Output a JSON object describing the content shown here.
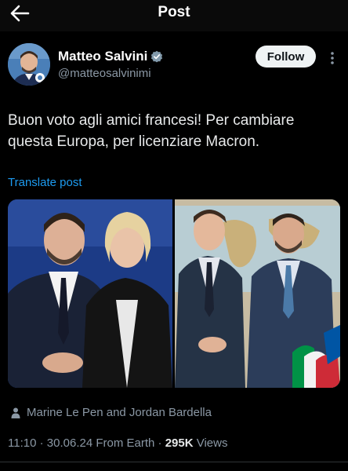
{
  "header": {
    "title": "Post",
    "back_icon": "arrow-left-icon",
    "more_icon": "more-vertical-icon"
  },
  "author": {
    "name": "Matteo Salvini",
    "handle": "@matteosalvinimi",
    "verified_icon": "verified-badge-icon",
    "follow_label": "Follow"
  },
  "post": {
    "text": "Buon voto agli amici francesi! Per cambiare questa Europa, per licenziare Macron.",
    "translate_label": "Translate post"
  },
  "tagged": {
    "icon": "person-icon",
    "label": "Marine Le Pen and Jordan Bardella"
  },
  "meta": {
    "time": "11:10",
    "sep1": " · ",
    "date": "30.06.24",
    "source": " From Earth",
    "sep2": " · ",
    "views_count": "295K",
    "views_label": " Views"
  },
  "colors": {
    "background": "#000000",
    "text": "#e7e9ea",
    "secondary": "#8b98a5",
    "link": "#1d9bf0",
    "follow_bg": "#eff3f4"
  }
}
